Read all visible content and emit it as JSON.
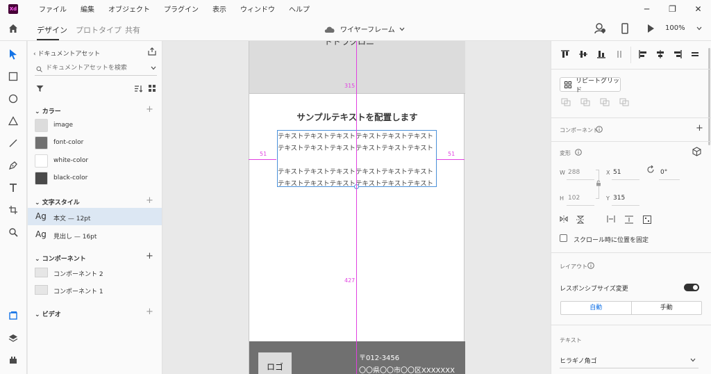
{
  "app": {
    "logo": "Xd",
    "menu": [
      "ファイル",
      "編集",
      "オブジェクト",
      "プラグイン",
      "表示",
      "ウィンドウ",
      "ヘルプ"
    ],
    "window_controls": {
      "minimize": "─",
      "restore": "❐",
      "close": "✕"
    }
  },
  "toolbar": {
    "tabs": [
      "デザイン",
      "プロトタイプ",
      "共有"
    ],
    "doc_title": "ワイヤーフレーム",
    "zoom": "100%"
  },
  "assets": {
    "back_label": "ドキュメントアセット",
    "search_placeholder": "ドキュメントアセットを検索",
    "colors_title": "カラー",
    "colors": [
      {
        "name": "image",
        "hex": "#dcdcdc"
      },
      {
        "name": "font-color",
        "hex": "#707070"
      },
      {
        "name": "white-color",
        "hex": "#ffffff"
      },
      {
        "name": "black-color",
        "hex": "#4a4a4a"
      }
    ],
    "char_styles_title": "文字スタイル",
    "char_styles": [
      {
        "glyph": "Ag",
        "label": "本文 — 12pt"
      },
      {
        "glyph": "Ag",
        "label": "見出し — 16pt"
      }
    ],
    "components_title": "コンポーネント",
    "components": [
      "コンポーネント 2",
      "コンポーネント 1"
    ],
    "video_title": "ビデオ"
  },
  "canvas": {
    "hero_text": "ドドラクロニ",
    "heading": "サンプルテキストを配置します",
    "body_lines": [
      "テキストテキストテキストテキストテキストテキスト",
      "テキストテキストテキストテキストテキストテキスト",
      "",
      "テキストテキストテキストテキストテキストテキスト",
      "テキストテキストテキストテキストテキストテキスト"
    ],
    "logo": "ロゴ",
    "postal": "〒012-3456",
    "address": "〇〇県〇〇市〇〇区XXXXXXX",
    "measures": {
      "top": "315",
      "left": "51",
      "right": "51",
      "bottom": "427"
    }
  },
  "props": {
    "repeat_grid": "リピートグリッド",
    "component_title": "コンポーネント",
    "transform_title": "変形",
    "w_label": "W",
    "w_value": "288",
    "x_label": "X",
    "x_value": "51",
    "rotate_value": "0°",
    "h_label": "H",
    "h_value": "102",
    "y_label": "Y",
    "y_value": "315",
    "fix_scroll": "スクロール時に位置を固定",
    "layout_title": "レイアウト",
    "responsive": "レスポンシブサイズ変更",
    "auto": "自動",
    "manual": "手動",
    "text_title": "テキスト",
    "font": "ヒラギノ角ゴ"
  }
}
